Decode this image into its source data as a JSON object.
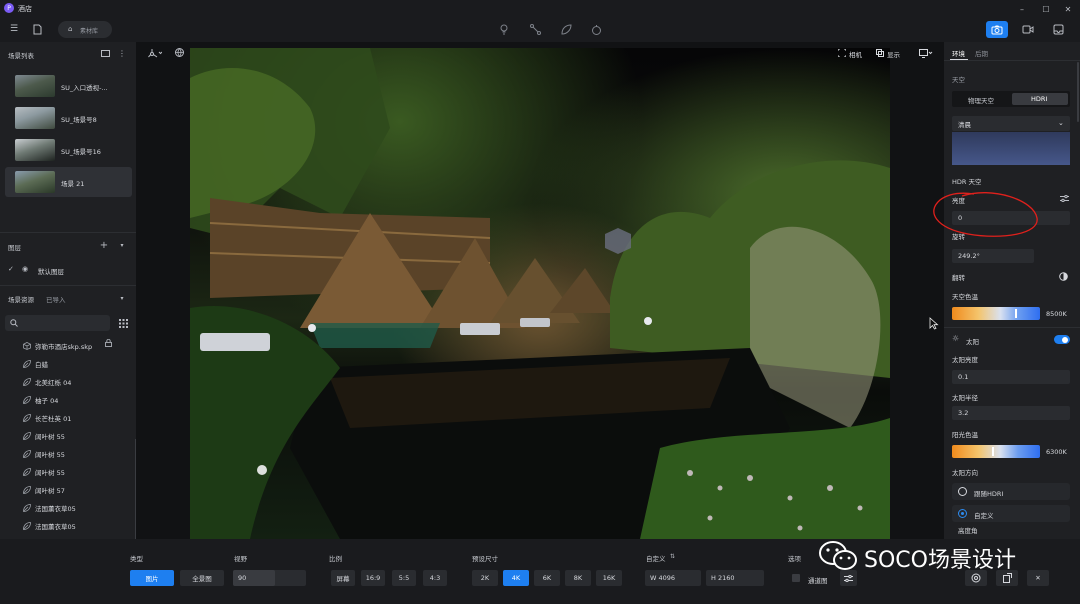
{
  "app": {
    "title": "酒店"
  },
  "toolbar": {
    "materials_label": "素材库"
  },
  "left": {
    "scene_list_title": "场景列表",
    "scenes": [
      {
        "label": "SU_入口透视-..."
      },
      {
        "label": "SU_场景号8"
      },
      {
        "label": "SU_场景号16"
      },
      {
        "label": "场景 21"
      }
    ],
    "layers_title": "图层",
    "default_layer": "默认图层",
    "assets_title": "场景资源",
    "assets_imported": "已导入",
    "assets": [
      {
        "label": "弥勒市酒店skp.skp",
        "icon": "cube-icon"
      },
      {
        "label": "白蜡",
        "icon": "leaf-icon"
      },
      {
        "label": "北美红栎 04",
        "icon": "leaf-icon"
      },
      {
        "label": "柚子 04",
        "icon": "leaf-icon"
      },
      {
        "label": "长芒杜英 01",
        "icon": "leaf-icon"
      },
      {
        "label": "阔叶树 55",
        "icon": "leaf-icon"
      },
      {
        "label": "阔叶树 55",
        "icon": "leaf-icon"
      },
      {
        "label": "阔叶树 55",
        "icon": "leaf-icon"
      },
      {
        "label": "阔叶树 57",
        "icon": "leaf-icon"
      },
      {
        "label": "法国薰衣草05",
        "icon": "leaf-icon"
      },
      {
        "label": "法国薰衣草05",
        "icon": "leaf-icon"
      }
    ]
  },
  "viewport": {
    "camera_label": "相机",
    "display_label": "显示"
  },
  "right": {
    "tabs": [
      "环境",
      "后期"
    ],
    "sky_title": "天空",
    "sky_modes": [
      "物理天空",
      "HDRI"
    ],
    "hdri_preset": "清晨",
    "hdr_sky_title": "HDR 天空",
    "brightness_label": "亮度",
    "brightness_value": "0",
    "rotation_label": "旋转",
    "rotation_value": "249.2°",
    "flip_label": "翻转",
    "sky_temp_label": "天空色温",
    "sky_temp_value": "8500K",
    "sky_temp_level": 0.72,
    "sun_label": "太阳",
    "sun_brightness_label": "太阳亮度",
    "sun_brightness_value": "0.1",
    "sun_radius_label": "太阳半径",
    "sun_radius_value": "3.2",
    "sunlight_temp_label": "阳光色温",
    "sunlight_temp_value": "6300K",
    "sunlight_temp_level": 0.46,
    "sun_direction_label": "太阳方向",
    "follow_hdri_label": "跟随HDRI",
    "custom_label": "自定义",
    "elevation_label": "高度角"
  },
  "bottom": {
    "type_label": "类型",
    "type_options": [
      "图片",
      "全景图"
    ],
    "fov_label": "视野",
    "fov_value": "90",
    "ratio_label": "比例",
    "ratio_options": [
      "屏幕",
      "16:9",
      "5:5",
      "4:3"
    ],
    "preset_label": "预设尺寸",
    "preset_options": [
      "2K",
      "4K",
      "6K",
      "8K",
      "16K"
    ],
    "custom_label": "自定义",
    "width_value": "W 4096",
    "height_value": "H 2160",
    "options_label": "选项",
    "channel_label": "通道图"
  },
  "watermark": {
    "text": "SOCO场景设计"
  },
  "colors": {
    "accent": "#1e7ff0",
    "annotation": "#e0201c"
  }
}
